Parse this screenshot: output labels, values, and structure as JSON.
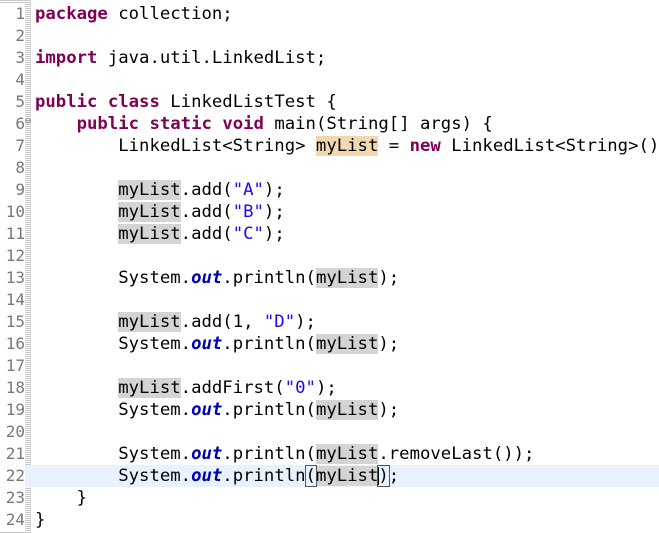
{
  "editor": {
    "lines": [
      {
        "n": "1",
        "tokens": [
          {
            "t": "package",
            "c": "kw"
          },
          {
            "t": " collection;"
          }
        ]
      },
      {
        "n": "2",
        "tokens": []
      },
      {
        "n": "3",
        "tokens": [
          {
            "t": "import",
            "c": "kw"
          },
          {
            "t": " java.util.LinkedList;"
          }
        ]
      },
      {
        "n": "4",
        "tokens": []
      },
      {
        "n": "5",
        "tokens": [
          {
            "t": "public",
            "c": "kw"
          },
          {
            "t": " "
          },
          {
            "t": "class",
            "c": "kw"
          },
          {
            "t": " LinkedListTest {"
          }
        ]
      },
      {
        "n": "6",
        "fold": "⊖",
        "tokens": [
          {
            "t": "    "
          },
          {
            "t": "public",
            "c": "kw"
          },
          {
            "t": " "
          },
          {
            "t": "static",
            "c": "kw"
          },
          {
            "t": " "
          },
          {
            "t": "void",
            "c": "kw"
          },
          {
            "t": " main(String[] args) {"
          }
        ]
      },
      {
        "n": "7",
        "tokens": [
          {
            "t": "        LinkedList<String> "
          },
          {
            "t": "myList",
            "c": "occ-write"
          },
          {
            "t": " = "
          },
          {
            "t": "new",
            "c": "kw"
          },
          {
            "t": " LinkedList<String>();"
          }
        ]
      },
      {
        "n": "8",
        "tokens": []
      },
      {
        "n": "9",
        "tokens": [
          {
            "t": "        "
          },
          {
            "t": "myList",
            "c": "occ"
          },
          {
            "t": ".add("
          },
          {
            "t": "\"A\"",
            "c": "str"
          },
          {
            "t": ");"
          }
        ]
      },
      {
        "n": "10",
        "tokens": [
          {
            "t": "        "
          },
          {
            "t": "myList",
            "c": "occ"
          },
          {
            "t": ".add("
          },
          {
            "t": "\"B\"",
            "c": "str"
          },
          {
            "t": ");"
          }
        ]
      },
      {
        "n": "11",
        "tokens": [
          {
            "t": "        "
          },
          {
            "t": "myList",
            "c": "occ"
          },
          {
            "t": ".add("
          },
          {
            "t": "\"C\"",
            "c": "str"
          },
          {
            "t": ");"
          }
        ]
      },
      {
        "n": "12",
        "tokens": []
      },
      {
        "n": "13",
        "tokens": [
          {
            "t": "        System."
          },
          {
            "t": "out",
            "c": "fld"
          },
          {
            "t": ".println("
          },
          {
            "t": "myList",
            "c": "occ"
          },
          {
            "t": ");"
          }
        ]
      },
      {
        "n": "14",
        "tokens": []
      },
      {
        "n": "15",
        "tokens": [
          {
            "t": "        "
          },
          {
            "t": "myList",
            "c": "occ"
          },
          {
            "t": ".add(1, "
          },
          {
            "t": "\"D\"",
            "c": "str"
          },
          {
            "t": ");"
          }
        ]
      },
      {
        "n": "16",
        "tokens": [
          {
            "t": "        System."
          },
          {
            "t": "out",
            "c": "fld"
          },
          {
            "t": ".println("
          },
          {
            "t": "myList",
            "c": "occ"
          },
          {
            "t": ");"
          }
        ]
      },
      {
        "n": "17",
        "tokens": []
      },
      {
        "n": "18",
        "tokens": [
          {
            "t": "        "
          },
          {
            "t": "myList",
            "c": "occ"
          },
          {
            "t": ".addFirst("
          },
          {
            "t": "\"0\"",
            "c": "str"
          },
          {
            "t": ");"
          }
        ]
      },
      {
        "n": "19",
        "tokens": [
          {
            "t": "        System."
          },
          {
            "t": "out",
            "c": "fld"
          },
          {
            "t": ".println("
          },
          {
            "t": "myList",
            "c": "occ"
          },
          {
            "t": ");"
          }
        ]
      },
      {
        "n": "20",
        "tokens": []
      },
      {
        "n": "21",
        "tokens": [
          {
            "t": "        System."
          },
          {
            "t": "out",
            "c": "fld"
          },
          {
            "t": ".println("
          },
          {
            "t": "myList",
            "c": "occ"
          },
          {
            "t": ".removeLast());"
          }
        ]
      },
      {
        "n": "22",
        "current": true,
        "tokens": [
          {
            "t": "        System."
          },
          {
            "t": "out",
            "c": "fld"
          },
          {
            "t": ".println"
          },
          {
            "t": "(",
            "c": "caret-bracket"
          },
          {
            "t": "myList",
            "c": "occ"
          },
          {
            "t": "|",
            "c": "text-caret"
          },
          {
            "t": ")",
            "c": "caret-bracket"
          },
          {
            "t": ";"
          }
        ]
      },
      {
        "n": "23",
        "tokens": [
          {
            "t": "    }"
          }
        ]
      },
      {
        "n": "24",
        "tokens": [
          {
            "t": "}"
          }
        ]
      }
    ]
  },
  "colors": {
    "keyword": "#7f0055",
    "string": "#2a00ff",
    "static_field": "#0000c0",
    "occurrence_highlight": "#d4d4d4",
    "write_occurrence_highlight": "#f2d8b1",
    "current_line": "#e8f2fe",
    "line_number": "#787878"
  }
}
